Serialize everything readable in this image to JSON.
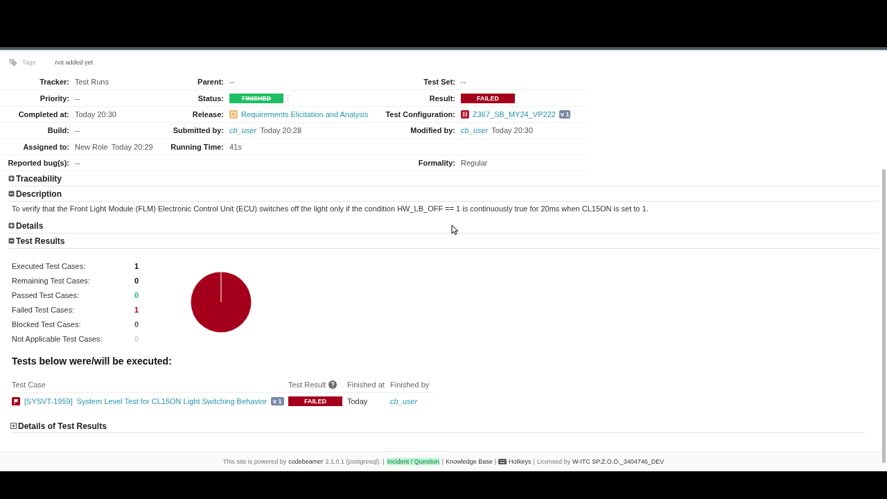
{
  "tags": {
    "label": "Tags:",
    "value": "not added yet"
  },
  "fields": [
    {
      "left": {
        "label": "Tracker:",
        "kind": "text",
        "value": "Test Runs"
      },
      "middle": {
        "label": "Parent:",
        "kind": "text",
        "value": "--"
      },
      "right": {
        "label": "Test Set:",
        "kind": "text",
        "value": "--"
      }
    },
    {
      "left": {
        "label": "Priority:",
        "kind": "text",
        "value": "--"
      },
      "middle": {
        "label": "Status:",
        "kind": "badge",
        "value": "FINISHED",
        "color": "#1dbf61",
        "strike": true,
        "menu": true
      },
      "right": {
        "label": "Result:",
        "kind": "badge",
        "value": "FAILED",
        "color": "#a5001b",
        "strike": false,
        "menu": false
      }
    },
    {
      "left": {
        "label": "Completed at:",
        "kind": "text",
        "value": "Today 20:30"
      },
      "middle": {
        "label": "Release:",
        "kind": "release",
        "value": "Requirements Elicitation and Analysis"
      },
      "right": {
        "label": "Test Configuration:",
        "kind": "config",
        "value": "Z367_SB_MY24_VP222",
        "version": "v 1"
      }
    },
    {
      "left": {
        "label": "Build:",
        "kind": "text",
        "value": "--"
      },
      "middle": {
        "label": "Submitted by:",
        "kind": "user",
        "user": "cb_user",
        "value": "Today 20:28"
      },
      "right": {
        "label": "Modified by:",
        "kind": "user",
        "user": "cb_user",
        "value": "Today 20:30"
      }
    },
    {
      "left": {
        "label": "Assigned to:",
        "kind": "text",
        "value": "New Role",
        "time": "Today 20:29"
      },
      "middle": {
        "label": "Running Time:",
        "kind": "text",
        "value": "41s"
      }
    },
    {
      "left": {
        "label": "Reported bug(s):",
        "kind": "text",
        "value": "--"
      },
      "right": {
        "label": "Formality:",
        "kind": "text",
        "value": "Regular"
      }
    }
  ],
  "sections": [
    {
      "title": "Traceability",
      "expanded": false
    },
    {
      "title": "Description",
      "expanded": true,
      "kind": "text",
      "text": "To verify that the Front Light Module (FLM) Electronic Control Unit (ECU) switches off the light only if the condition HW_LB_OFF == 1 is continuously true for 20ms when CL15ON is set to 1."
    },
    {
      "title": "Details",
      "expanded": false
    },
    {
      "title": "Test Results",
      "expanded": true,
      "kind": "results"
    }
  ],
  "results": {
    "stats": [
      {
        "label": "Executed Test Cases:",
        "value": "1",
        "color": "#111111"
      },
      {
        "label": "Remaining Test Cases:",
        "value": "0",
        "color": "#111111"
      },
      {
        "label": "Passed Test Cases:",
        "value": "0",
        "color": "#1dbf61"
      },
      {
        "label": "Failed Test Cases:",
        "value": "1",
        "color": "#a5001b"
      },
      {
        "label": "Blocked Test Cases:",
        "value": "0",
        "color": "#555555"
      },
      {
        "label": "Not Applicable Test Cases:",
        "value": "0",
        "color": "#cccccc"
      }
    ],
    "heading": "Tests below were/will be executed:",
    "columns": [
      "Test Case",
      "Test Result",
      "Finished at",
      "Finished by"
    ],
    "rows": [
      {
        "id": "[SYSVT-1959]",
        "name": "System Level Test for CL15ON Light Switching Behavior",
        "version": "v 1",
        "result": "FAILED",
        "color": "#a5001b",
        "finished_at": "Today",
        "finished_by": "cb_user"
      }
    ],
    "details": {
      "title": "Details of Test Results",
      "expanded": false
    }
  },
  "footer": [
    {
      "kind": "text",
      "value": "This site is powered by"
    },
    {
      "kind": "strong",
      "value": "codebeamer"
    },
    {
      "kind": "text",
      "value": "2.1.0.1 (postgresql)."
    },
    {
      "kind": "sep",
      "value": "|"
    },
    {
      "kind": "highlight",
      "value": "Incident / Question"
    },
    {
      "kind": "sep",
      "value": "|"
    },
    {
      "kind": "link",
      "value": "Knowledge Base"
    },
    {
      "kind": "sep",
      "value": "|"
    },
    {
      "kind": "hotkeys",
      "value": "Hotkeys"
    },
    {
      "kind": "sep",
      "value": "|"
    },
    {
      "kind": "text",
      "value": "Licensed by"
    },
    {
      "kind": "strong",
      "value": "W-ITC SP.Z.O.O._3404746_DEV"
    }
  ]
}
